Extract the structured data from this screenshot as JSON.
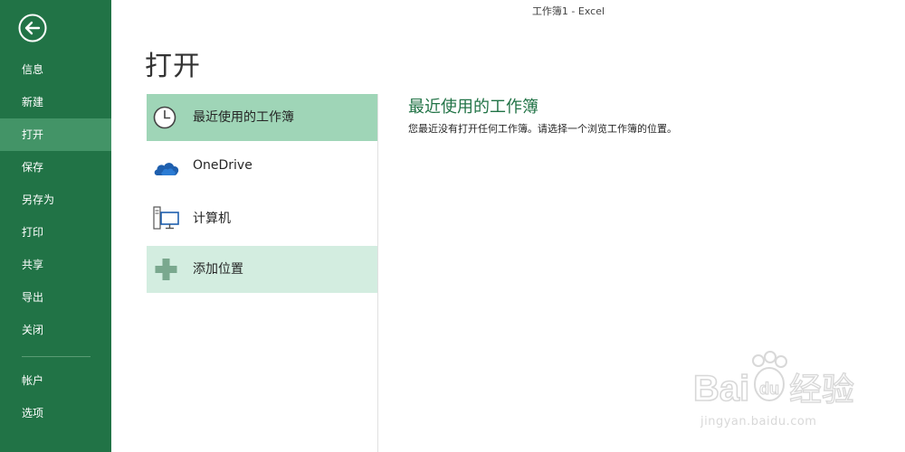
{
  "window": {
    "title": "工作簿1 - Excel"
  },
  "sidebar": {
    "items": [
      {
        "label": "信息"
      },
      {
        "label": "新建"
      },
      {
        "label": "打开",
        "active": true
      },
      {
        "label": "保存"
      },
      {
        "label": "另存为"
      },
      {
        "label": "打印"
      },
      {
        "label": "共享"
      },
      {
        "label": "导出"
      },
      {
        "label": "关闭"
      }
    ],
    "bottom_items": [
      {
        "label": "帐户"
      },
      {
        "label": "选项"
      }
    ]
  },
  "page": {
    "title": "打开"
  },
  "places": [
    {
      "label": "最近使用的工作簿",
      "icon": "clock-icon",
      "selected": true
    },
    {
      "label": "OneDrive",
      "icon": "cloud-icon"
    },
    {
      "label": "计算机",
      "icon": "computer-icon"
    },
    {
      "label": "添加位置",
      "icon": "plus-icon",
      "hover": true
    }
  ],
  "detail": {
    "heading": "最近使用的工作簿",
    "text": "您最近没有打开任何工作簿。请选择一个浏览工作簿的位置。"
  },
  "watermark": {
    "logo_text": "Baidu 经验",
    "url": "jingyan.baidu.com"
  },
  "colors": {
    "sidebar_bg": "#217346",
    "sidebar_active": "#439467",
    "place_selected": "#9fd5b7",
    "place_hover": "#d3ede0",
    "accent_text": "#217346"
  }
}
